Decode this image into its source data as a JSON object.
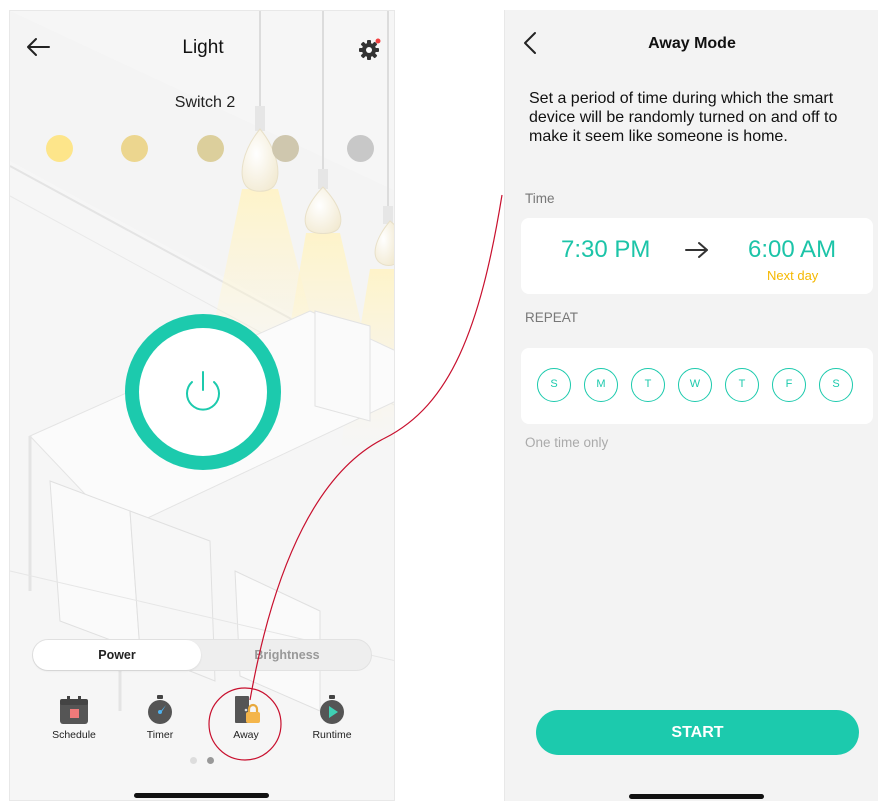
{
  "left_screen": {
    "title": "Light",
    "switch_name": "Switch 2",
    "swatch_colors": [
      "#fde58a",
      "#ecd68f",
      "#dccf9c",
      "#cfc7ae",
      "#c8c8c8"
    ],
    "accent_color": "#1ccaad",
    "icons": {
      "back": "back-arrow-icon",
      "settings": "gear-icon",
      "power": "power-icon"
    },
    "tabs": [
      {
        "label": "Power",
        "selected": true
      },
      {
        "label": "Brightness",
        "selected": false
      }
    ],
    "toolbar": [
      {
        "label": "Schedule",
        "icon": "calendar-icon"
      },
      {
        "label": "Timer",
        "icon": "stopwatch-icon"
      },
      {
        "label": "Away",
        "icon": "away-lock-icon"
      },
      {
        "label": "Runtime",
        "icon": "runtime-play-icon"
      }
    ],
    "pager": {
      "pages": 2,
      "current": 2
    }
  },
  "right_screen": {
    "title": "Away Mode",
    "description": "Set a period of time during which the smart device will be randomly turned on and off to make it seem like someone is home.",
    "time_section_label": "Time",
    "start_time": "7:30 PM",
    "end_time": "6:00 AM",
    "end_note": "Next day",
    "repeat_section_label": "REPEAT",
    "days": [
      "S",
      "M",
      "T",
      "W",
      "T",
      "F",
      "S"
    ],
    "repeat_hint": "One time only",
    "start_button": "START"
  }
}
